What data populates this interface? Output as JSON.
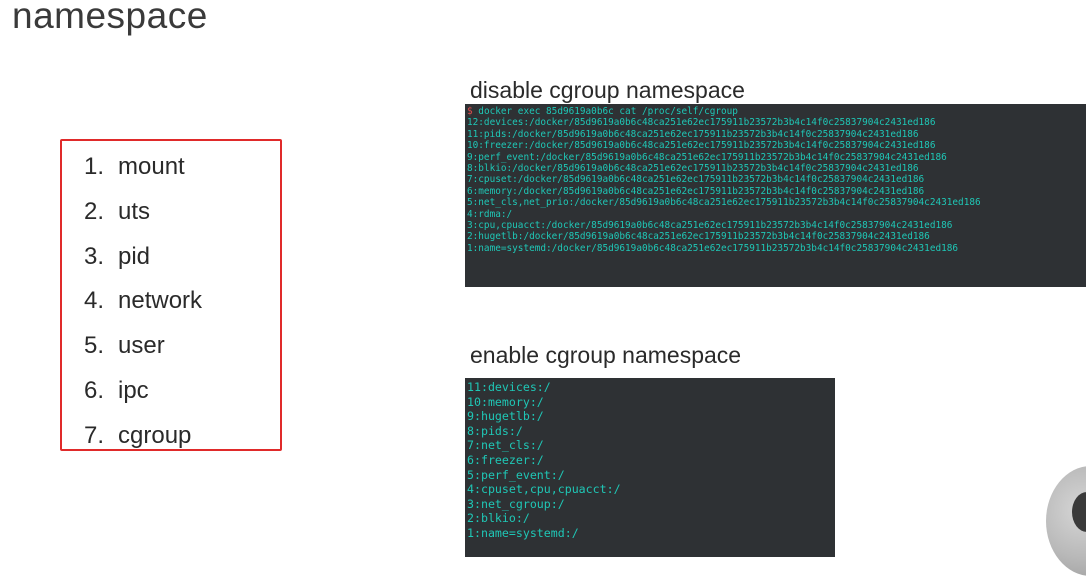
{
  "slide": {
    "title": "namespace"
  },
  "namespaces": [
    {
      "num": "1.",
      "name": "mount"
    },
    {
      "num": "2.",
      "name": "uts"
    },
    {
      "num": "3.",
      "name": "pid"
    },
    {
      "num": "4.",
      "name": "network"
    },
    {
      "num": "5.",
      "name": "user"
    },
    {
      "num": "6.",
      "name": "ipc"
    },
    {
      "num": "7.",
      "name": "cgroup"
    }
  ],
  "disable_section": {
    "heading": "disable cgroup namespace",
    "prompt_symbol": "$",
    "command": " docker exec 85d9619a0b6c cat /proc/self/cgroup",
    "lines": [
      "12:devices:/docker/85d9619a0b6c48ca251e62ec175911b23572b3b4c14f0c25837904c2431ed186",
      "11:pids:/docker/85d9619a0b6c48ca251e62ec175911b23572b3b4c14f0c25837904c2431ed186",
      "10:freezer:/docker/85d9619a0b6c48ca251e62ec175911b23572b3b4c14f0c25837904c2431ed186",
      "9:perf_event:/docker/85d9619a0b6c48ca251e62ec175911b23572b3b4c14f0c25837904c2431ed186",
      "8:blkio:/docker/85d9619a0b6c48ca251e62ec175911b23572b3b4c14f0c25837904c2431ed186",
      "7:cpuset:/docker/85d9619a0b6c48ca251e62ec175911b23572b3b4c14f0c25837904c2431ed186",
      "6:memory:/docker/85d9619a0b6c48ca251e62ec175911b23572b3b4c14f0c25837904c2431ed186",
      "5:net_cls,net_prio:/docker/85d9619a0b6c48ca251e62ec175911b23572b3b4c14f0c25837904c2431ed186",
      "4:rdma:/",
      "3:cpu,cpuacct:/docker/85d9619a0b6c48ca251e62ec175911b23572b3b4c14f0c25837904c2431ed186",
      "2:hugetlb:/docker/85d9619a0b6c48ca251e62ec175911b23572b3b4c14f0c25837904c2431ed186",
      "1:name=systemd:/docker/85d9619a0b6c48ca251e62ec175911b23572b3b4c14f0c25837904c2431ed186"
    ]
  },
  "enable_section": {
    "heading": "enable cgroup namespace",
    "lines": [
      "11:devices:/",
      "10:memory:/",
      "9:hugetlb:/",
      "8:pids:/",
      "7:net_cls:/",
      "6:freezer:/",
      "5:perf_event:/",
      "4:cpuset,cpu,cpuacct:/",
      "3:net_cgroup:/",
      "2:blkio:/",
      "1:name=systemd:/"
    ]
  },
  "colors": {
    "box_border": "#e02a2a",
    "terminal_bg": "#2e3134",
    "terminal_text": "#1fc7b6",
    "prompt": "#e04d4d"
  }
}
